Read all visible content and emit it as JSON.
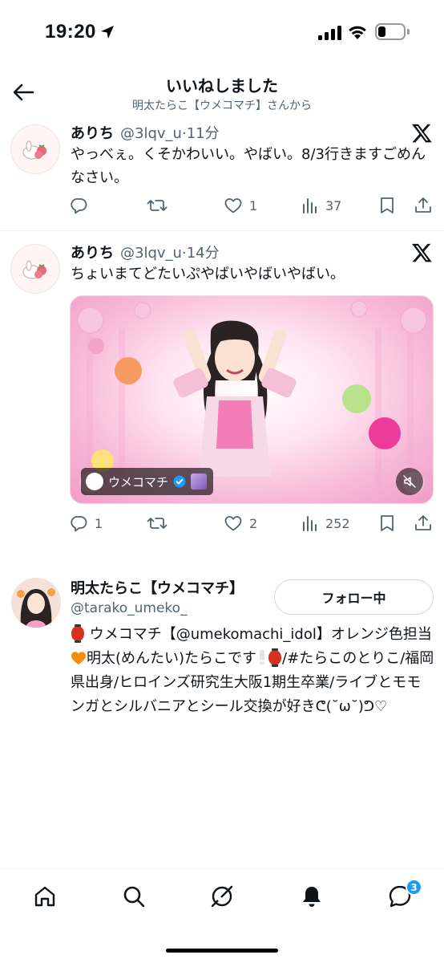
{
  "status_bar": {
    "time": "19:20"
  },
  "header": {
    "title": "いいねしました",
    "subtitle": "明太たらこ【ウメコマチ】さんから"
  },
  "tweets": [
    {
      "name": "ありち",
      "handle": "@3lqv_u",
      "separator": "·",
      "time": "11分",
      "text": "やっべぇ。くそかわいい。やばい。8/3行きますごめんなさい。",
      "replies": "",
      "retweets": "",
      "likes": "1",
      "views": "37"
    },
    {
      "name": "ありち",
      "handle": "@3lqv_u",
      "separator": "·",
      "time": "14分",
      "text": "ちょいまてどたいぷやばいやばいやばい。",
      "media_tag": "ウメコマチ",
      "replies": "1",
      "retweets": "",
      "likes": "2",
      "views": "252"
    }
  ],
  "profile_card": {
    "name": "明太たらこ【ウメコマチ】",
    "handle": "@tarako_umeko_",
    "follow_label": "フォロー中",
    "bio_1": "ウメコマチ【@umekomachi_idol】オレンジ色担当",
    "bio_2": "明太(めんたい)たらこです",
    "bio_3": "/#たらこのとりこ/福岡県出身/ヒロインズ研究生大阪1期生卒業/ライブとモモンガとシルバニアとシール交換が好きᕦ(˘ω˘)ᕤ♡"
  },
  "bottom_nav": {
    "messages_badge": "3"
  },
  "colors": {
    "accent": "#1d9bf0",
    "muted": "#536471",
    "divider": "#eff3f4",
    "orange_heart": "#f4900c",
    "lantern": "#d9301e"
  }
}
